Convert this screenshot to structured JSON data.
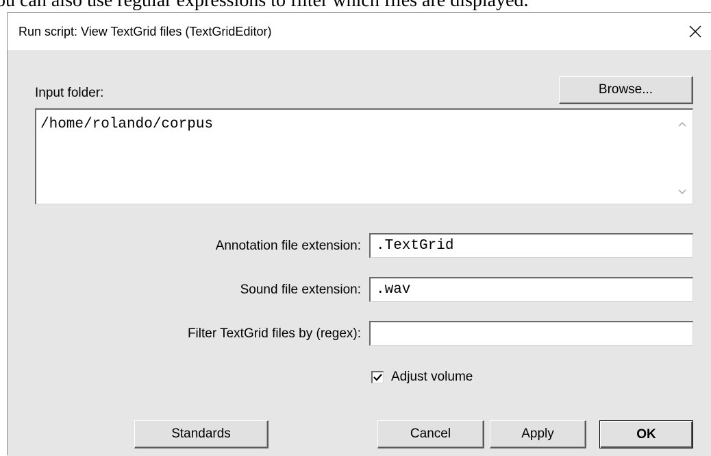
{
  "background_caption": "ou can also use regular expressions to filter which files are displayed.",
  "window": {
    "title": "Run script: View TextGrid files (TextGridEditor)",
    "close_icon": "close-icon"
  },
  "input_folder": {
    "label": "Input folder:",
    "browse_label": "Browse...",
    "value": "/home/rolando/corpus"
  },
  "fields": {
    "annotation_label": "Annotation file extension:",
    "annotation_value": ".TextGrid",
    "sound_label": "Sound file extension:",
    "sound_value": ".wav",
    "filter_label": "Filter TextGrid files by (regex):",
    "filter_value": ""
  },
  "adjust_volume": {
    "label": "Adjust volume",
    "checked": true
  },
  "buttons": {
    "standards": "Standards",
    "cancel": "Cancel",
    "apply": "Apply",
    "ok": "OK"
  }
}
